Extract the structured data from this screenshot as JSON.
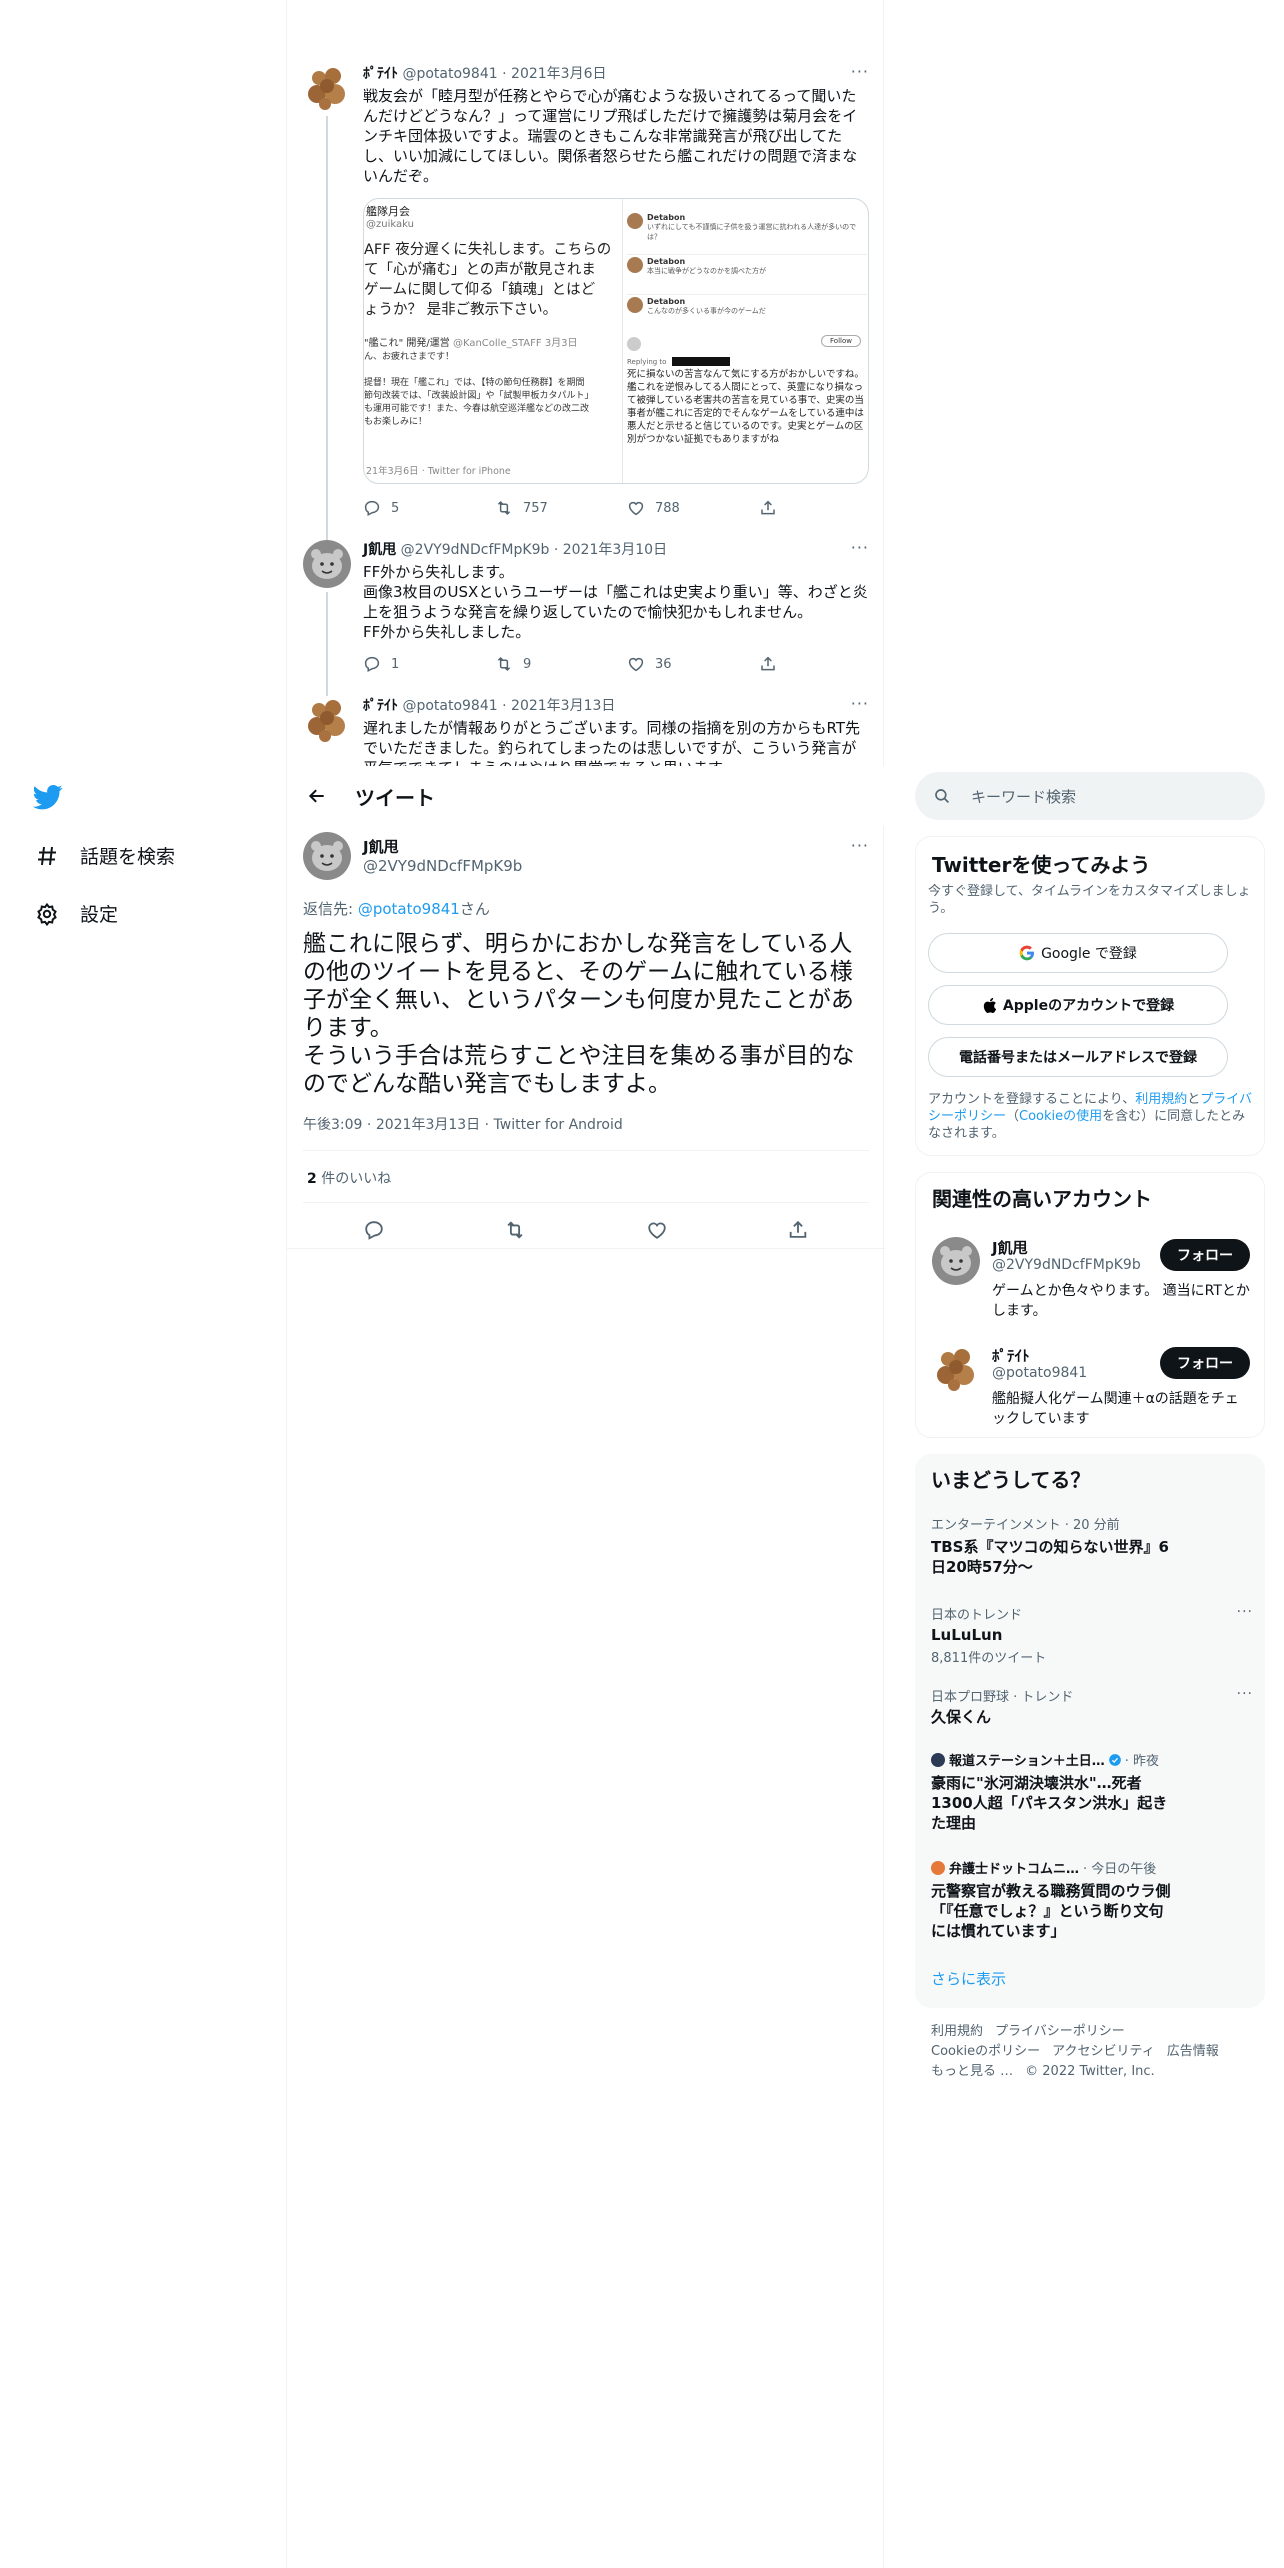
{
  "sidebar": {
    "explore_label": "話題を検索",
    "settings_label": "設定"
  },
  "thread": [
    {
      "name": "ﾎﾟﾃｲﾄ",
      "handle": "@potato9841",
      "date": "2021年3月6日",
      "text": "戦友会が「睦月型が任務とやらで心が痛むような扱いされてるって聞いたんだけどどうなん？」って運営にリプ飛ばしただけで擁護勢は菊月会をインチキ団体扱いですよ。瑞雲のときもこんな非常識発言が飛び出してたし、いい加減にしてほしい。関係者怒らせたら艦これだけの問題で済まないんだぞ。",
      "replies": "5",
      "retweets": "757",
      "likes": "788"
    },
    {
      "name": "J飢甩",
      "handle": "@2VY9dNDcfFMpK9b",
      "date": "2021年3月10日",
      "text": "FF外から失礼します。\n画像3枚目のUSXというユーザーは「艦これは史実より重い」等、わざと炎上を狙うような発言を繰り返していたので愉快犯かもしれません。\nFF外から失礼しました。",
      "replies": "1",
      "retweets": "9",
      "likes": "36"
    },
    {
      "name": "ﾎﾟﾃｲﾄ",
      "handle": "@potato9841",
      "date": "2021年3月13日",
      "text": "遅れましたが情報ありがとうございます。同様の指摘を別の方からもRT先でいただきました。釣られてしまったのは悲しいですが、こういう発言が平気でできてしまうのはやはり異常であると思います。"
    }
  ],
  "media": {
    "left_header": "艦隊月会",
    "left_sub": "@zuikaku",
    "left_big": "AFF 夜分遅くに失礼します。こちらの\nて「心が痛む」との声が散見されま\nゲームに関して仰る「鎮魂」とはど\nょうか？ 是非ご教示下さい。",
    "left_quote_name": "\"艦これ\" 開発/運営",
    "left_quote_handle": "@KanColle_STAFF",
    "left_quote_date": "3月3日",
    "left_quote_text": "ん、お疲れさまです！\n\n提督！現在「艦これ」では、【特の節句任務群】を期間\n節句改装では、「改装設計図」や「試製甲板カタパルト」\nも運用可能です！また、今春は航空巡洋艦などの改二改\nもお楽しみに！",
    "left_footer": "21年3月6日 · Twitter for iPhone",
    "right_lines": [
      "Detabon",
      "いずれにしても不謹慎に子供を扱う運営に抗われる人達が多いのでは？",
      "Detabon",
      "本当に戦争がどうなのかを調べた方が",
      "Detabon",
      "こんなのが多くいる事が今のゲームだ"
    ],
    "right_follow": "Follow",
    "right_reply": "Replying to",
    "right_text": "死に損ないの苦言なんて気にする方がおかしいですね。艦これを逆恨みしてる人間にとって、英霊になり損なって被弾している老害共の苦言を見ている事で、史実の当事者が艦これに否定的でそんなゲームをしている連中は悪人だと示せると信じているのです。史実とゲームの区別がつかない証拠でもありますがね"
  },
  "header": {
    "title": "ツイート"
  },
  "focus": {
    "name": "J飢甩",
    "handle": "@2VY9dNDcfFMpK9b",
    "reply_prefix": "返信先: ",
    "reply_target": "@potato9841",
    "reply_suffix": "さん",
    "text": "艦これに限らず、明らかにおかしな発言をしている人の他のツイートを見ると、そのゲームに触れている様子が全く無い、というパターンも何度か見たことがあります。\nそういう手合は荒らすことや注目を集める事が目的なのでどんな酷い発言でもしますよ。",
    "time": "午後3:09",
    "date": "2021年3月13日",
    "client": "Twitter for Android",
    "like_count": "2",
    "like_label": " 件のいいね"
  },
  "search": {
    "placeholder": "キーワード検索"
  },
  "signup": {
    "title": "Twitterを使ってみよう",
    "desc": "今すぐ登録して、タイムラインをカスタマイズしましょう。",
    "google": "Google で登録",
    "apple": "Appleのアカウントで登録",
    "phone": "電話番号またはメールアドレスで登録",
    "legal_1": "アカウントを登録することにより、",
    "legal_terms": "利用規約",
    "legal_2": "と",
    "legal_privacy": "プライバシーポリシー",
    "legal_3": "（",
    "legal_cookie": "Cookieの使用",
    "legal_4": "を含む）に同意したとみなされます。"
  },
  "related": {
    "title": "関連性の高いアカウント",
    "accounts": [
      {
        "name": "J飢甩",
        "handle": "@2VY9dNDcfFMpK9b",
        "bio": "ゲームとか色々やります。 適当にRTとかします。",
        "follow": "フォロー"
      },
      {
        "name": "ﾎﾟﾃｲﾄ",
        "handle": "@potato9841",
        "bio": "艦船擬人化ゲーム関連＋αの話題をチェックしています",
        "follow": "フォロー"
      }
    ]
  },
  "trends": {
    "title": "いまどうしてる？",
    "items": [
      {
        "cat": "エンターテインメント · 20 分前",
        "title": "TBS系『マツコの知らない世界』6日20時57分〜"
      },
      {
        "cat": "日本のトレンド",
        "title": "LuLuLun",
        "sub": "8,811件のツイート"
      },
      {
        "cat": "日本プロ野球 · トレンド",
        "title": "久保くん"
      },
      {
        "cat": "報道ステーション＋土日…",
        "when": "· 昨夜",
        "title": "豪雨に\"氷河湖決壊洪水\"…死者1300人超「パキスタン洪水」起きた理由"
      },
      {
        "cat": "弁護士ドットコムニ…",
        "when": "· 今日の午後",
        "title": "元警察官が教える職務質問のウラ側「『任意でしょ？』という断り文句には慣れています」"
      }
    ],
    "more": "さらに表示"
  },
  "footer": {
    "terms": "利用規約",
    "privacy": "プライバシーポリシー",
    "cookie": "Cookieのポリシー",
    "access": "アクセシビリティ",
    "ads": "広告情報",
    "more": "もっと見る …",
    "copy": "© 2022 Twitter, Inc."
  },
  "colors": {
    "brand": "#1d9bf0",
    "text": "#0f1419",
    "secondary": "#536471"
  },
  "icons": [
    "twitter-bird-icon",
    "hashtag-icon",
    "gear-icon",
    "back-arrow-icon",
    "search-icon",
    "reply-icon",
    "retweet-icon",
    "like-icon",
    "share-icon",
    "more-icon",
    "google-icon",
    "apple-icon",
    "verified-icon"
  ]
}
